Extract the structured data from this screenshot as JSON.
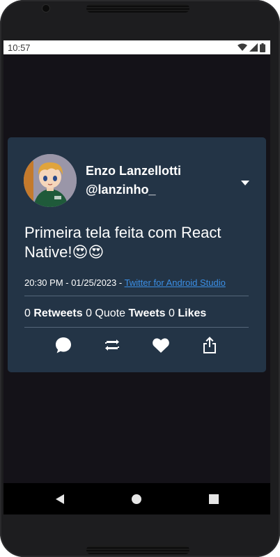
{
  "status_bar": {
    "time": "10:57",
    "icons": [
      "wifi-icon",
      "signal-icon",
      "battery-icon"
    ]
  },
  "tweet": {
    "display_name": "Enzo Lanzellotti",
    "handle": "@lanzinho_",
    "text": "Primeira tela feita com React Native!",
    "emojis": "😍😍",
    "date_prefix": "20:30 PM - 01/25/2023 - ",
    "source": "Twitter for Android Studio",
    "stats": {
      "retweets_count": "0",
      "retweets_label": "Retweets",
      "quote_count": "0",
      "quote_label": "Quote",
      "tweets_label": "Tweets",
      "likes_count": "0",
      "likes_label": "Likes"
    },
    "actions": [
      "comment-icon",
      "retweet-icon",
      "like-icon",
      "share-icon"
    ]
  },
  "nav_bar": [
    "back-icon",
    "home-icon",
    "recents-icon"
  ],
  "colors": {
    "card_bg": "#233446",
    "screen_bg": "#141218",
    "link": "#3b8fe5",
    "text": "#ffffff"
  }
}
